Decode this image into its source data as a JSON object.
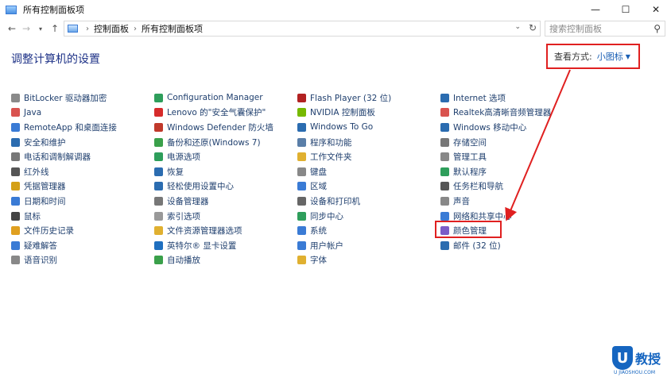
{
  "window": {
    "title": "所有控制面板项"
  },
  "window_buttons": {
    "minimize": "—",
    "maximize": "☐",
    "close": "✕"
  },
  "address": {
    "crumbs": [
      "控制面板",
      "所有控制面板项"
    ],
    "separator": "›"
  },
  "search": {
    "placeholder": "搜索控制面板"
  },
  "header": {
    "title": "调整计算机的设置",
    "view_by_label": "查看方式:",
    "view_by_value": "小图标"
  },
  "columns": [
    [
      {
        "label": "BitLocker 驱动器加密",
        "color": "#8a8a8a"
      },
      {
        "label": "Java",
        "color": "#d9534f"
      },
      {
        "label": "RemoteApp 和桌面连接",
        "color": "#3a7bd5"
      },
      {
        "label": "安全和维护",
        "color": "#2b6cb0"
      },
      {
        "label": "电话和调制解调器",
        "color": "#777777"
      },
      {
        "label": "红外线",
        "color": "#555555"
      },
      {
        "label": "凭据管理器",
        "color": "#d4a017"
      },
      {
        "label": "日期和时间",
        "color": "#3a7bd5"
      },
      {
        "label": "鼠标",
        "color": "#444444"
      },
      {
        "label": "文件历史记录",
        "color": "#e0a020"
      },
      {
        "label": "疑难解答",
        "color": "#3a7bd5"
      },
      {
        "label": "语音识别",
        "color": "#888888"
      }
    ],
    [
      {
        "label": "Configuration Manager",
        "color": "#2e9e5b"
      },
      {
        "label": "Lenovo 的\"安全气囊保护\"",
        "color": "#d62b2b"
      },
      {
        "label": "Windows Defender 防火墙",
        "color": "#c0392b"
      },
      {
        "label": "备份和还原(Windows 7)",
        "color": "#3aa04a"
      },
      {
        "label": "电源选项",
        "color": "#2e9e5b"
      },
      {
        "label": "恢复",
        "color": "#2b6cb0"
      },
      {
        "label": "轻松使用设置中心",
        "color": "#2b6cb0"
      },
      {
        "label": "设备管理器",
        "color": "#777777"
      },
      {
        "label": "索引选项",
        "color": "#999999"
      },
      {
        "label": "文件资源管理器选项",
        "color": "#e0b030"
      },
      {
        "label": "英特尔® 显卡设置",
        "color": "#1f6fbf"
      },
      {
        "label": "自动播放",
        "color": "#3aa04a"
      }
    ],
    [
      {
        "label": "Flash Player (32 位)",
        "color": "#b22222"
      },
      {
        "label": "NVIDIA 控制面板",
        "color": "#76b900"
      },
      {
        "label": "Windows To Go",
        "color": "#2b6cb0"
      },
      {
        "label": "程序和功能",
        "color": "#5a7ea8"
      },
      {
        "label": "工作文件夹",
        "color": "#e0b030"
      },
      {
        "label": "键盘",
        "color": "#888888"
      },
      {
        "label": "区域",
        "color": "#3a7bd5"
      },
      {
        "label": "设备和打印机",
        "color": "#666666"
      },
      {
        "label": "同步中心",
        "color": "#2e9e5b"
      },
      {
        "label": "系统",
        "color": "#3a7bd5"
      },
      {
        "label": "用户帐户",
        "color": "#3a7bd5"
      },
      {
        "label": "字体",
        "color": "#e0b030"
      }
    ],
    [
      {
        "label": "Internet 选项",
        "color": "#2b6cb0"
      },
      {
        "label": "Realtek高清晰音频管理器",
        "color": "#d9534f"
      },
      {
        "label": "Windows 移动中心",
        "color": "#2b6cb0"
      },
      {
        "label": "存储空间",
        "color": "#777777"
      },
      {
        "label": "管理工具",
        "color": "#888888"
      },
      {
        "label": "默认程序",
        "color": "#2e9e5b"
      },
      {
        "label": "任务栏和导航",
        "color": "#555555"
      },
      {
        "label": "声音",
        "color": "#888888"
      },
      {
        "label": "网络和共享中心",
        "color": "#3a7bd5"
      },
      {
        "label": "颜色管理",
        "color": "#7b5cc8"
      },
      {
        "label": "邮件 (32 位)",
        "color": "#2b6cb0"
      }
    ]
  ],
  "watermark": {
    "mark": "U",
    "text": "教授",
    "sub": "U JIAOSHOU.COM"
  }
}
